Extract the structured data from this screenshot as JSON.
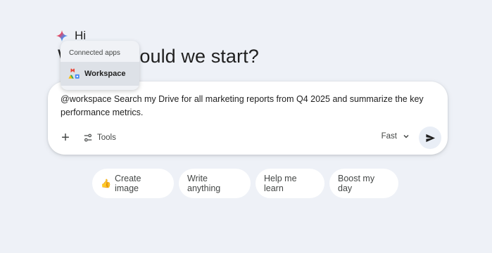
{
  "greeting": {
    "hi": "Hi",
    "headline": "Where should we start?"
  },
  "popup": {
    "title": "Connected apps",
    "items": [
      {
        "label": "Workspace",
        "icon": "workspace-icon"
      }
    ]
  },
  "prompt": {
    "text": "@workspace Search my Drive for all marketing reports from Q4 2025 and summarize the key performance metrics."
  },
  "toolbar": {
    "add_label": "+",
    "tools_label": "Tools",
    "model_label": "Fast"
  },
  "chips": [
    {
      "label": "Create image",
      "icon": "👍"
    },
    {
      "label": "Write anything"
    },
    {
      "label": "Help me learn"
    },
    {
      "label": "Boost my day"
    }
  ],
  "colors": {
    "background": "#eef1f7",
    "card": "#ffffff",
    "popup": "#f0f2f6",
    "popup_selected": "#dde1e7",
    "text": "#1f1f1f",
    "muted": "#444746"
  }
}
